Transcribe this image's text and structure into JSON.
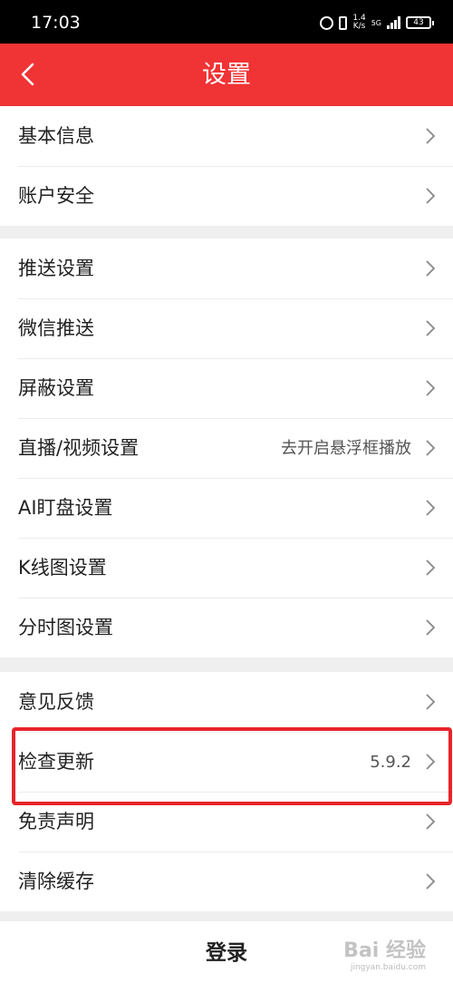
{
  "status_bar": {
    "time": "17:03",
    "net_speed_value": "1.4",
    "net_speed_unit": "K/s",
    "net_type": "5G",
    "battery": "43"
  },
  "header": {
    "title": "设置"
  },
  "groups": [
    {
      "items": [
        {
          "label": "基本信息"
        },
        {
          "label": "账户安全"
        }
      ]
    },
    {
      "items": [
        {
          "label": "推送设置"
        },
        {
          "label": "微信推送"
        },
        {
          "label": "屏蔽设置"
        },
        {
          "label": "直播/视频设置",
          "value": "去开启悬浮框播放"
        },
        {
          "label": "AI盯盘设置"
        },
        {
          "label": "K线图设置"
        },
        {
          "label": "分时图设置"
        }
      ]
    },
    {
      "items": [
        {
          "label": "意见反馈"
        },
        {
          "label": "检查更新",
          "value": "5.9.2"
        },
        {
          "label": "免责声明"
        },
        {
          "label": "清除缓存"
        }
      ]
    }
  ],
  "login": {
    "label": "登录"
  },
  "watermark": {
    "text": "Bai 经验",
    "sub": "jingyan.baidu.com"
  },
  "colors": {
    "header_bg": "#f03335",
    "highlight": "#e8242b"
  }
}
